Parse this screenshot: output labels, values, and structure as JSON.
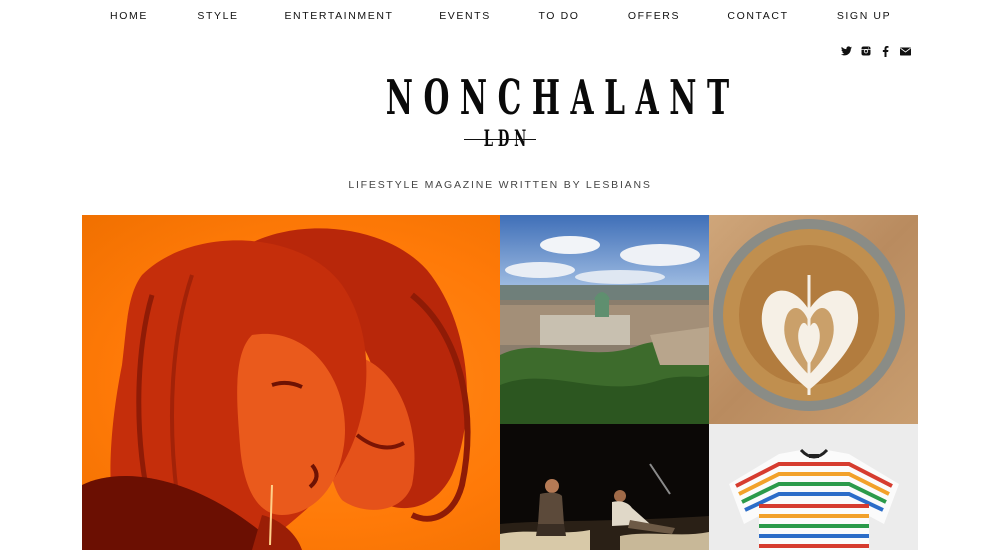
{
  "nav": {
    "items": [
      {
        "label": "HOME"
      },
      {
        "label": "STYLE"
      },
      {
        "label": "ENTERTAINMENT"
      },
      {
        "label": "EVENTS"
      },
      {
        "label": "TO DO"
      },
      {
        "label": "OFFERS"
      },
      {
        "label": "CONTACT"
      },
      {
        "label": "SIGN UP"
      }
    ]
  },
  "social": {
    "icons": [
      "twitter-icon",
      "instagram-icon",
      "facebook-icon",
      "envelope-icon"
    ]
  },
  "brand": {
    "logo_text": "NONCHALANT",
    "logo_subtext": "LDN",
    "tagline": "LIFESTYLE MAGAZINE WRITTEN BY LESBIANS"
  },
  "colors": {
    "feature_orange": "#ff7a08",
    "text": "#111111"
  },
  "featured_images": [
    {
      "subject": "two-faces-orange-portrait"
    },
    {
      "subject": "city-panorama-with-dome"
    },
    {
      "subject": "latte-art-coffee"
    },
    {
      "subject": "two-people-on-stage"
    },
    {
      "subject": "rainbow-striped-tshirt"
    }
  ]
}
